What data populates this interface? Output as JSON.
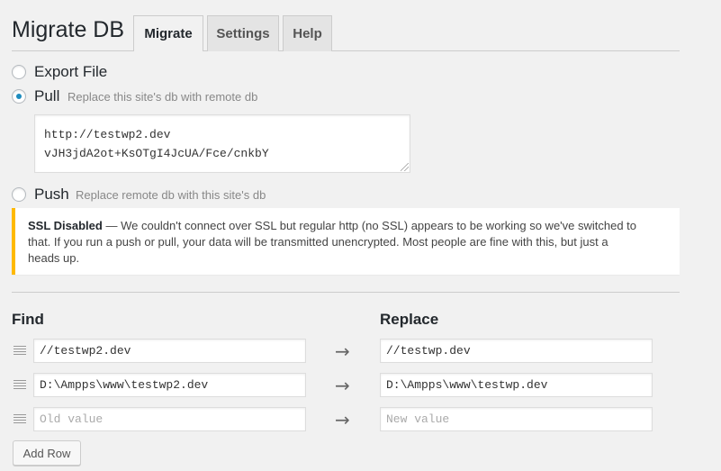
{
  "header": {
    "title": "Migrate DB",
    "tabs": [
      {
        "label": "Migrate",
        "active": true
      },
      {
        "label": "Settings",
        "active": false
      },
      {
        "label": "Help",
        "active": false
      }
    ]
  },
  "actions": {
    "export": {
      "label": "Export File"
    },
    "pull": {
      "label": "Pull",
      "desc": "Replace this site's db with remote db",
      "checked": true
    },
    "push": {
      "label": "Push",
      "desc": "Replace remote db with this site's db"
    }
  },
  "connection": {
    "url": "http://testwp2.dev",
    "key": "vJH3jdA2ot+KsOTgI4JcUA/Fce/cnkbY"
  },
  "notice": {
    "title": "SSL Disabled",
    "line1": "— We couldn't connect over SSL but regular http (no SSL) appears to be working so we've switched to",
    "line2": "that. If you run a push or pull, your data will be transmitted unencrypted. Most people are fine with this, but just a",
    "line3": "heads up.",
    "accent": "#ffb900"
  },
  "find_replace": {
    "find_label": "Find",
    "replace_label": "Replace",
    "rows": [
      {
        "find": "//testwp2.dev",
        "replace": "//testwp.dev"
      },
      {
        "find": "D:\\Ampps\\www\\testwp2.dev",
        "replace": "D:\\Ampps\\www\\testwp.dev"
      },
      {
        "find": "",
        "replace": "",
        "find_placeholder": "Old value",
        "replace_placeholder": "New value"
      }
    ],
    "arrow_glyph": "→",
    "add_row_label": "Add Row"
  },
  "colors": {
    "radio_checked": "#1e8cbe",
    "notice_border": "#ffb900"
  },
  "icons": {
    "drag_handle": "drag-handle-icon",
    "arrow": "arrow-right-icon",
    "resize": "resize-grip-icon"
  }
}
